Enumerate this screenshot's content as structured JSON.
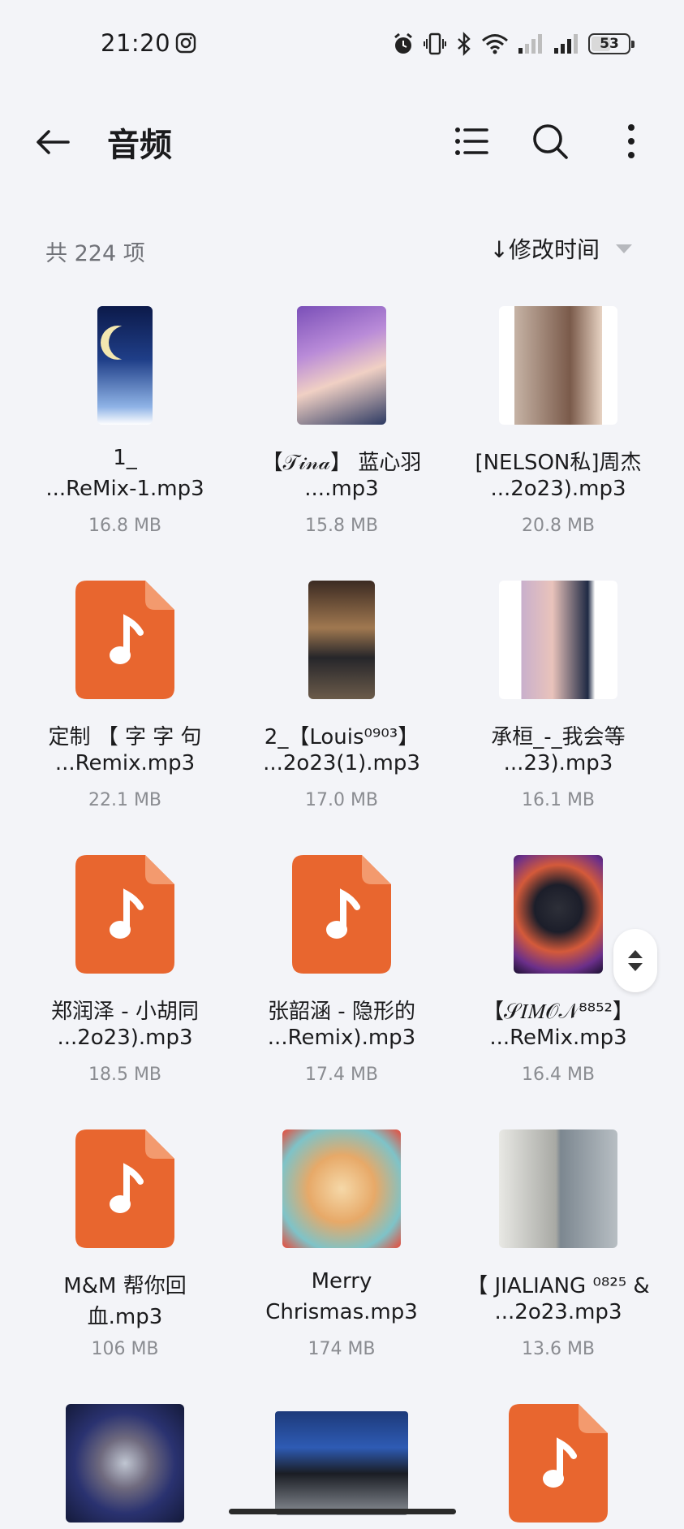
{
  "status_bar": {
    "time": "21:20",
    "battery": "53",
    "battery_level": 0.53
  },
  "header": {
    "title": "音频",
    "back_icon": "arrow-left-icon"
  },
  "toolbar": {
    "list_icon": "list-icon",
    "search_icon": "search-icon",
    "more_icon": "more-vertical-icon"
  },
  "list_info": {
    "count_text": "共 224 项",
    "sort_label": "↓修改时间"
  },
  "colors": {
    "accent": "#e8662f",
    "background": "#f3f4f8",
    "secondary_text": "#8a8c91"
  },
  "files": [
    {
      "line1": "1_",
      "line2": "...ReMix-1.mp3",
      "size": "16.8 MB",
      "thumb": "photo"
    },
    {
      "line1": "【𝒯𝒾𝓃𝒶】 蓝心羽",
      "line2": "....mp3",
      "size": "15.8 MB",
      "thumb": "photo"
    },
    {
      "line1": "[NELSON私]周杰",
      "line2": "...2o23).mp3",
      "size": "20.8 MB",
      "thumb": "photo"
    },
    {
      "line1": "定制 【 字 字 句",
      "line2": "...Remix.mp3",
      "size": "22.1 MB",
      "thumb": "music-file-icon"
    },
    {
      "line1": "2_【Louis⁰⁹⁰³】",
      "line2": "...2o23(1).mp3",
      "size": "17.0 MB",
      "thumb": "photo"
    },
    {
      "line1": "承桓_-_我会等",
      "line2": "...23).mp3",
      "size": "16.1 MB",
      "thumb": "photo"
    },
    {
      "line1": "郑润泽 - 小胡同",
      "line2": "...2o23).mp3",
      "size": "18.5 MB",
      "thumb": "music-file-icon"
    },
    {
      "line1": "张韶涵 - 隐形的",
      "line2": "...Remix).mp3",
      "size": "17.4 MB",
      "thumb": "music-file-icon"
    },
    {
      "line1": "【𝒮𝐼𝑀𝒪𝒩⁸⁸⁵²】",
      "line2": "...ReMix.mp3",
      "size": "16.4 MB",
      "thumb": "photo"
    },
    {
      "line1": "M&M 帮你回",
      "line2": "血.mp3",
      "size": "106 MB",
      "thumb": "music-file-icon"
    },
    {
      "line1": "Merry",
      "line2": "Chrismas.mp3",
      "size": "174 MB",
      "thumb": "photo"
    },
    {
      "line1": "【 JIALIANG ⁰⁸²⁵ &",
      "line2": "...2o23.mp3",
      "size": "13.6 MB",
      "thumb": "photo"
    }
  ],
  "partial_row_thumbs": [
    "photo",
    "photo",
    "music-file-icon"
  ]
}
